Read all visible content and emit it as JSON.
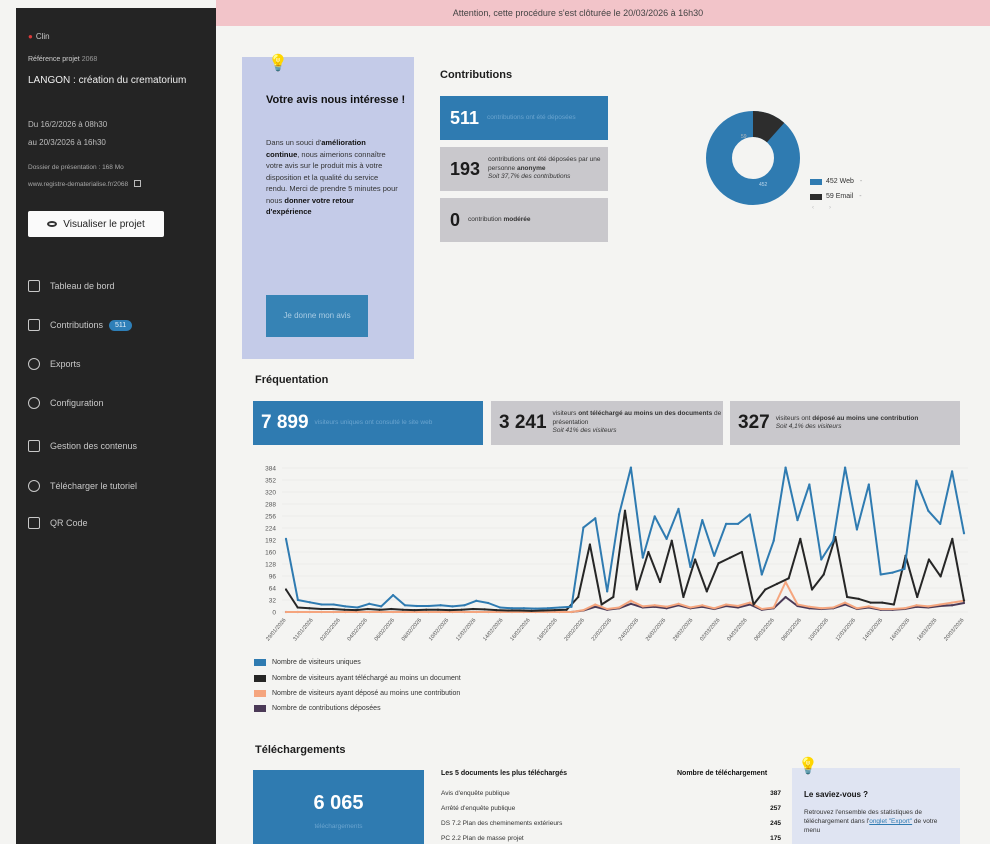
{
  "alert": "Attention, cette procédure s'est clôturée le 20/03/2026 à 16h30",
  "sidebar": {
    "client": "Clin",
    "ref_label": "Référence projet",
    "ref_code": "2068",
    "title": "LANGON : création du crematorium",
    "date_from": "Du 16/2/2026 à 08h30",
    "date_to": "au 20/3/2026 à 16h30",
    "docs": "Dossier de présentation : 168 Mo",
    "url": "www.registre-dematerialise.fr/2068",
    "view_button": "Visualiser le projet",
    "nav": [
      {
        "label": "Tableau de bord"
      },
      {
        "label": "Contributions",
        "badge": "511"
      },
      {
        "label": "Exports"
      },
      {
        "label": "Configuration"
      },
      {
        "label": "Gestion des contenus"
      },
      {
        "label": "Télécharger le tutoriel"
      },
      {
        "label": "QR Code"
      }
    ]
  },
  "feedback": {
    "title": "Votre avis nous intéresse !",
    "t1": "Dans un souci d'",
    "t1b": "amélioration continue",
    "t2": ", nous aimerions connaître votre avis sur le produit mis à votre disposition et la qualité du service rendu. Merci de prendre 5 minutes pour nous ",
    "t2b": "donner votre retour d'expérience",
    "button": "Je donne mon avis"
  },
  "contributions": {
    "title": "Contributions",
    "total": "511",
    "total_text": "contributions ont été déposées",
    "anon": "193",
    "anon_text": "contributions ont été déposées par une personne",
    "anon_bold": "anonyme",
    "anon_pct": "Soit 37,7% des contributions",
    "moderated": "0",
    "moderated_text": "contribution",
    "moderated_bold": "modérée",
    "donut_labels": [
      "452 Web",
      "59 Email"
    ],
    "donut_small": "59",
    "donut_big": "452",
    "colors": {
      "web": "#2f7bb1",
      "email": "#2d2d2d"
    }
  },
  "frequentation": {
    "title": "Fréquentation",
    "visitors": "7 899",
    "visitors_text": "visiteurs uniques ont consulté le site web",
    "downloaders": "3 241",
    "downloaders_text": "visiteurs",
    "downloaders_bold": "ont téléchargé au moins un des documents",
    "downloaders_tail": "de présentation",
    "downloaders_pct": "Soit 41% des visiteurs",
    "contributors": "327",
    "contributors_text": "visiteurs ont",
    "contributors_bold": "déposé au moins une contribution",
    "contributors_pct": "Soit 4,1% des visiteurs"
  },
  "chart_data": {
    "type": "line",
    "y_ticks": [
      0,
      32,
      64,
      96,
      128,
      160,
      192,
      224,
      256,
      288,
      320,
      352,
      384
    ],
    "ylim": [
      0,
      384
    ],
    "x_labels": [
      "29/01/2026",
      "31/01/2026",
      "02/02/2026",
      "04/02/2026",
      "06/02/2026",
      "08/02/2026",
      "10/02/2026",
      "12/02/2026",
      "14/02/2026",
      "16/02/2026",
      "18/02/2026",
      "20/02/2026",
      "22/02/2026",
      "24/02/2026",
      "26/02/2026",
      "28/02/2026",
      "02/03/2026",
      "04/03/2026",
      "06/03/2026",
      "08/03/2026",
      "10/03/2026",
      "12/03/2026",
      "14/03/2026",
      "16/03/2026",
      "18/03/2026",
      "20/03/2026"
    ],
    "series": [
      {
        "name": "Nombre de visiteurs uniques",
        "color": "#2f7bb1",
        "values": [
          195,
          32,
          26,
          20,
          20,
          15,
          12,
          22,
          15,
          45,
          18,
          16,
          16,
          18,
          15,
          18,
          30,
          24,
          12,
          10,
          10,
          9,
          10,
          12,
          14,
          225,
          250,
          55,
          260,
          385,
          145,
          255,
          195,
          275,
          120,
          245,
          150,
          235,
          235,
          260,
          100,
          190,
          385,
          245,
          340,
          140,
          190,
          385,
          220,
          340,
          100,
          105,
          115,
          350,
          270,
          235,
          375,
          210
        ]
      },
      {
        "name": "Nombre de visiteurs ayant téléchargé au moins un document",
        "color": "#262626",
        "values": [
          60,
          12,
          10,
          8,
          8,
          6,
          5,
          8,
          6,
          8,
          6,
          5,
          6,
          6,
          5,
          6,
          8,
          7,
          5,
          4,
          4,
          3,
          4,
          5,
          6,
          40,
          180,
          20,
          40,
          270,
          60,
          160,
          80,
          190,
          40,
          140,
          55,
          130,
          145,
          160,
          20,
          60,
          75,
          90,
          195,
          60,
          100,
          200,
          40,
          35,
          25,
          25,
          20,
          150,
          40,
          140,
          95,
          195,
          30
        ]
      },
      {
        "name": "Nombre de visiteurs ayant déposé au moins une contribution",
        "color": "#f5a57e",
        "values": [
          0,
          0,
          0,
          0,
          0,
          0,
          0,
          0,
          0,
          0,
          0,
          0,
          0,
          0,
          0,
          0,
          0,
          0,
          0,
          0,
          0,
          0,
          0,
          0,
          0,
          5,
          20,
          8,
          12,
          30,
          15,
          18,
          14,
          22,
          12,
          18,
          10,
          20,
          16,
          25,
          8,
          12,
          80,
          20,
          14,
          10,
          12,
          25,
          10,
          15,
          8,
          8,
          10,
          18,
          15,
          20,
          25,
          30
        ]
      },
      {
        "name": "Nombre de contributions déposées",
        "color": "#4b3a57",
        "values": [
          0,
          0,
          0,
          0,
          0,
          0,
          0,
          0,
          0,
          0,
          0,
          0,
          0,
          0,
          0,
          0,
          0,
          0,
          0,
          0,
          0,
          0,
          0,
          0,
          0,
          4,
          14,
          6,
          10,
          22,
          12,
          14,
          10,
          18,
          10,
          14,
          8,
          16,
          12,
          20,
          6,
          10,
          40,
          16,
          10,
          8,
          10,
          20,
          8,
          12,
          6,
          6,
          8,
          14,
          12,
          16,
          18,
          24
        ]
      }
    ]
  },
  "downloads": {
    "title": "Téléchargements",
    "total": "6 065",
    "total_text": "téléchargements",
    "top5_title": "Les 5 documents les plus téléchargés",
    "count_header": "Nombre de téléchargement",
    "rows": [
      {
        "name": "Avis d'enquête publique",
        "count": "387"
      },
      {
        "name": "Arrêté d'enquête publique",
        "count": "257"
      },
      {
        "name": "DS 7.2 Plan des cheminements extérieurs",
        "count": "245"
      },
      {
        "name": "PC 2.2 Plan de masse projet",
        "count": "175"
      }
    ]
  },
  "tip": {
    "title": "Le saviez-vous ?",
    "text": "Retrouvez l'ensemble des statistiques de téléchargement dans l'",
    "link": "onglet \"Export\"",
    "text2": " de votre menu"
  }
}
